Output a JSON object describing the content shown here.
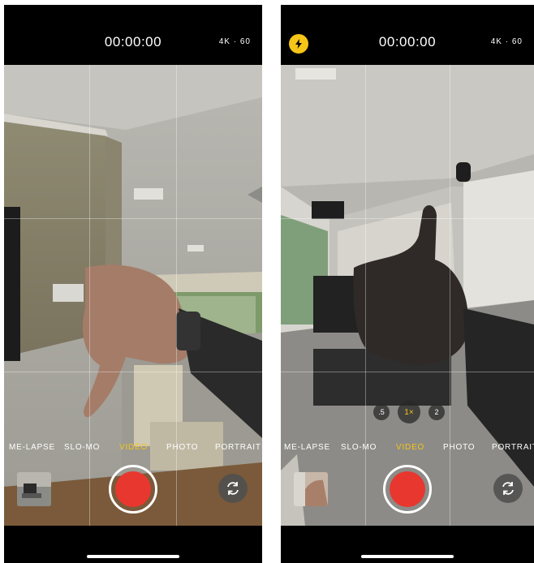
{
  "left": {
    "timer": "00:00:00",
    "format": "4K · 60",
    "modes": [
      "ME-LAPSE",
      "SLO-MO",
      "VIDEO",
      "PHOTO",
      "PORTRAIT"
    ],
    "active_mode": "VIDEO"
  },
  "right": {
    "timer": "00:00:00",
    "format": "4K · 60",
    "modes": [
      "ME-LAPSE",
      "SLO-MO",
      "VIDEO",
      "PHOTO",
      "PORTRAIT"
    ],
    "active_mode": "VIDEO",
    "zoom": [
      ".5",
      "1×",
      "2"
    ],
    "active_zoom": "1×"
  },
  "colors": {
    "accent_yellow": "#f5c518",
    "shutter_red": "#e8372f",
    "bar_black": "#000000"
  },
  "icons": {
    "flash": "lightning-bolt-icon",
    "flip": "camera-flip-icon"
  }
}
